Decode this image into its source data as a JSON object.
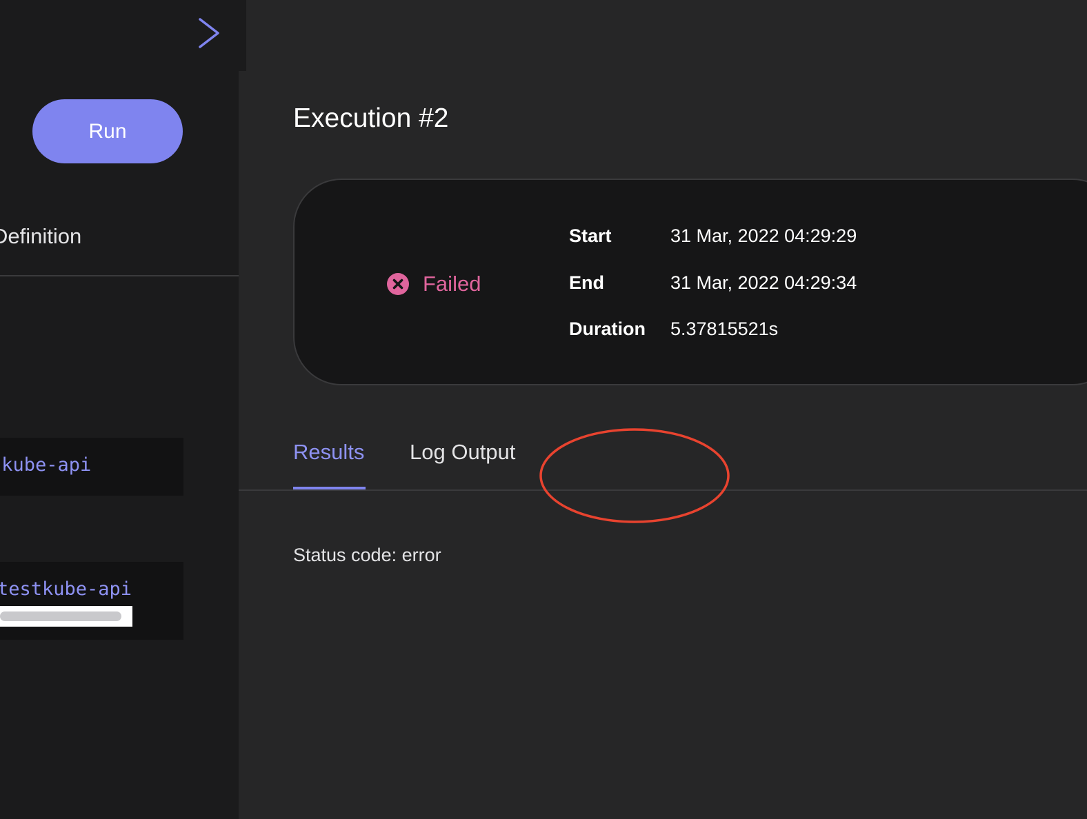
{
  "sidebar": {
    "run_label": "Run",
    "section_label": "Definition",
    "code_1": "tkube-api",
    "code_2": "testkube-api"
  },
  "main": {
    "title": "Execution #2",
    "status": "Failed",
    "meta": [
      {
        "key": "Start",
        "value": "31 Mar, 2022 04:29:29"
      },
      {
        "key": "End",
        "value": "31 Mar, 2022 04:29:34"
      },
      {
        "key": "Duration",
        "value": "5.37815521s"
      }
    ],
    "tabs": [
      {
        "label": "Results",
        "active": true
      },
      {
        "label": "Log Output",
        "active": false
      }
    ],
    "result_text": "Status code: error"
  },
  "colors": {
    "accent": "#7f84ef",
    "failed": "#e0659d",
    "annotation": "#e8432f",
    "background": "#262627",
    "sidebar": "#1b1b1c"
  },
  "icons": {
    "toggle": "chevron-right-icon",
    "status": "failed-x-circle-icon"
  }
}
